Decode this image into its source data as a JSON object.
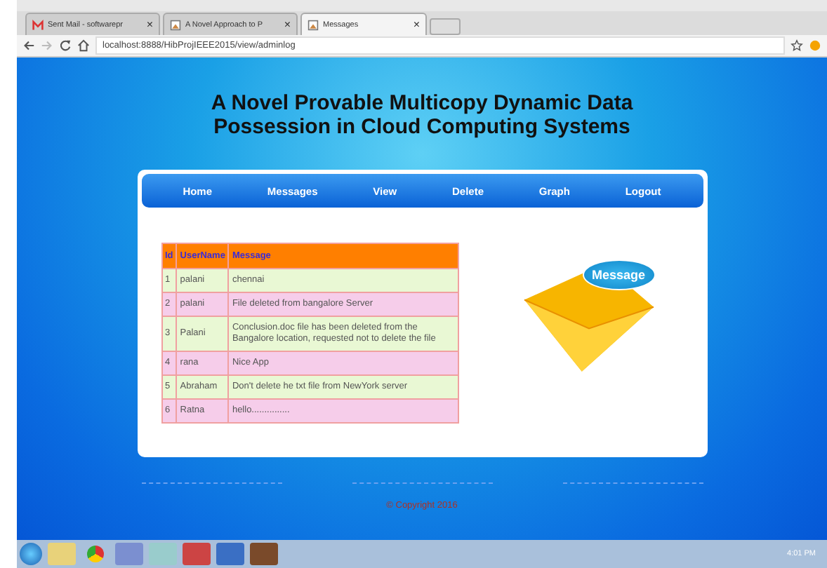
{
  "browser": {
    "tabs": [
      {
        "label": "Sent Mail - softwarepr",
        "selected": false,
        "kind": "mail"
      },
      {
        "label": "A Novel Approach to P",
        "selected": false,
        "kind": "page"
      },
      {
        "label": "Messages",
        "selected": true,
        "kind": "page"
      }
    ],
    "close_glyph": "×",
    "address": "localhost:8888/HibProjIEEE2015/view/adminlog"
  },
  "page": {
    "title": "A Novel Provable Multicopy Dynamic Data Possession in Cloud Computing Systems",
    "nav": [
      "Home",
      "Messages",
      "View",
      "Delete",
      "Graph",
      "Logout"
    ],
    "table": {
      "columns": [
        "Id",
        "UserName",
        "Message"
      ],
      "rows": [
        [
          "1",
          "palani",
          "chennai"
        ],
        [
          "2",
          "palani",
          "File deleted from bangalore Server"
        ],
        [
          "3",
          "Palani",
          "Conclusion.doc file has been deleted from the Bangalore location, requested not to delete the file"
        ],
        [
          "4",
          "rana",
          "Nice App"
        ],
        [
          "5",
          "Abraham",
          "Don't delete he txt file from NewYork server"
        ],
        [
          "6",
          "Ratna",
          "hello..............."
        ]
      ]
    },
    "illustration_label": "Message",
    "copyright": "© Copyright 2016"
  },
  "taskbar": {
    "clock": "4:01 PM"
  }
}
